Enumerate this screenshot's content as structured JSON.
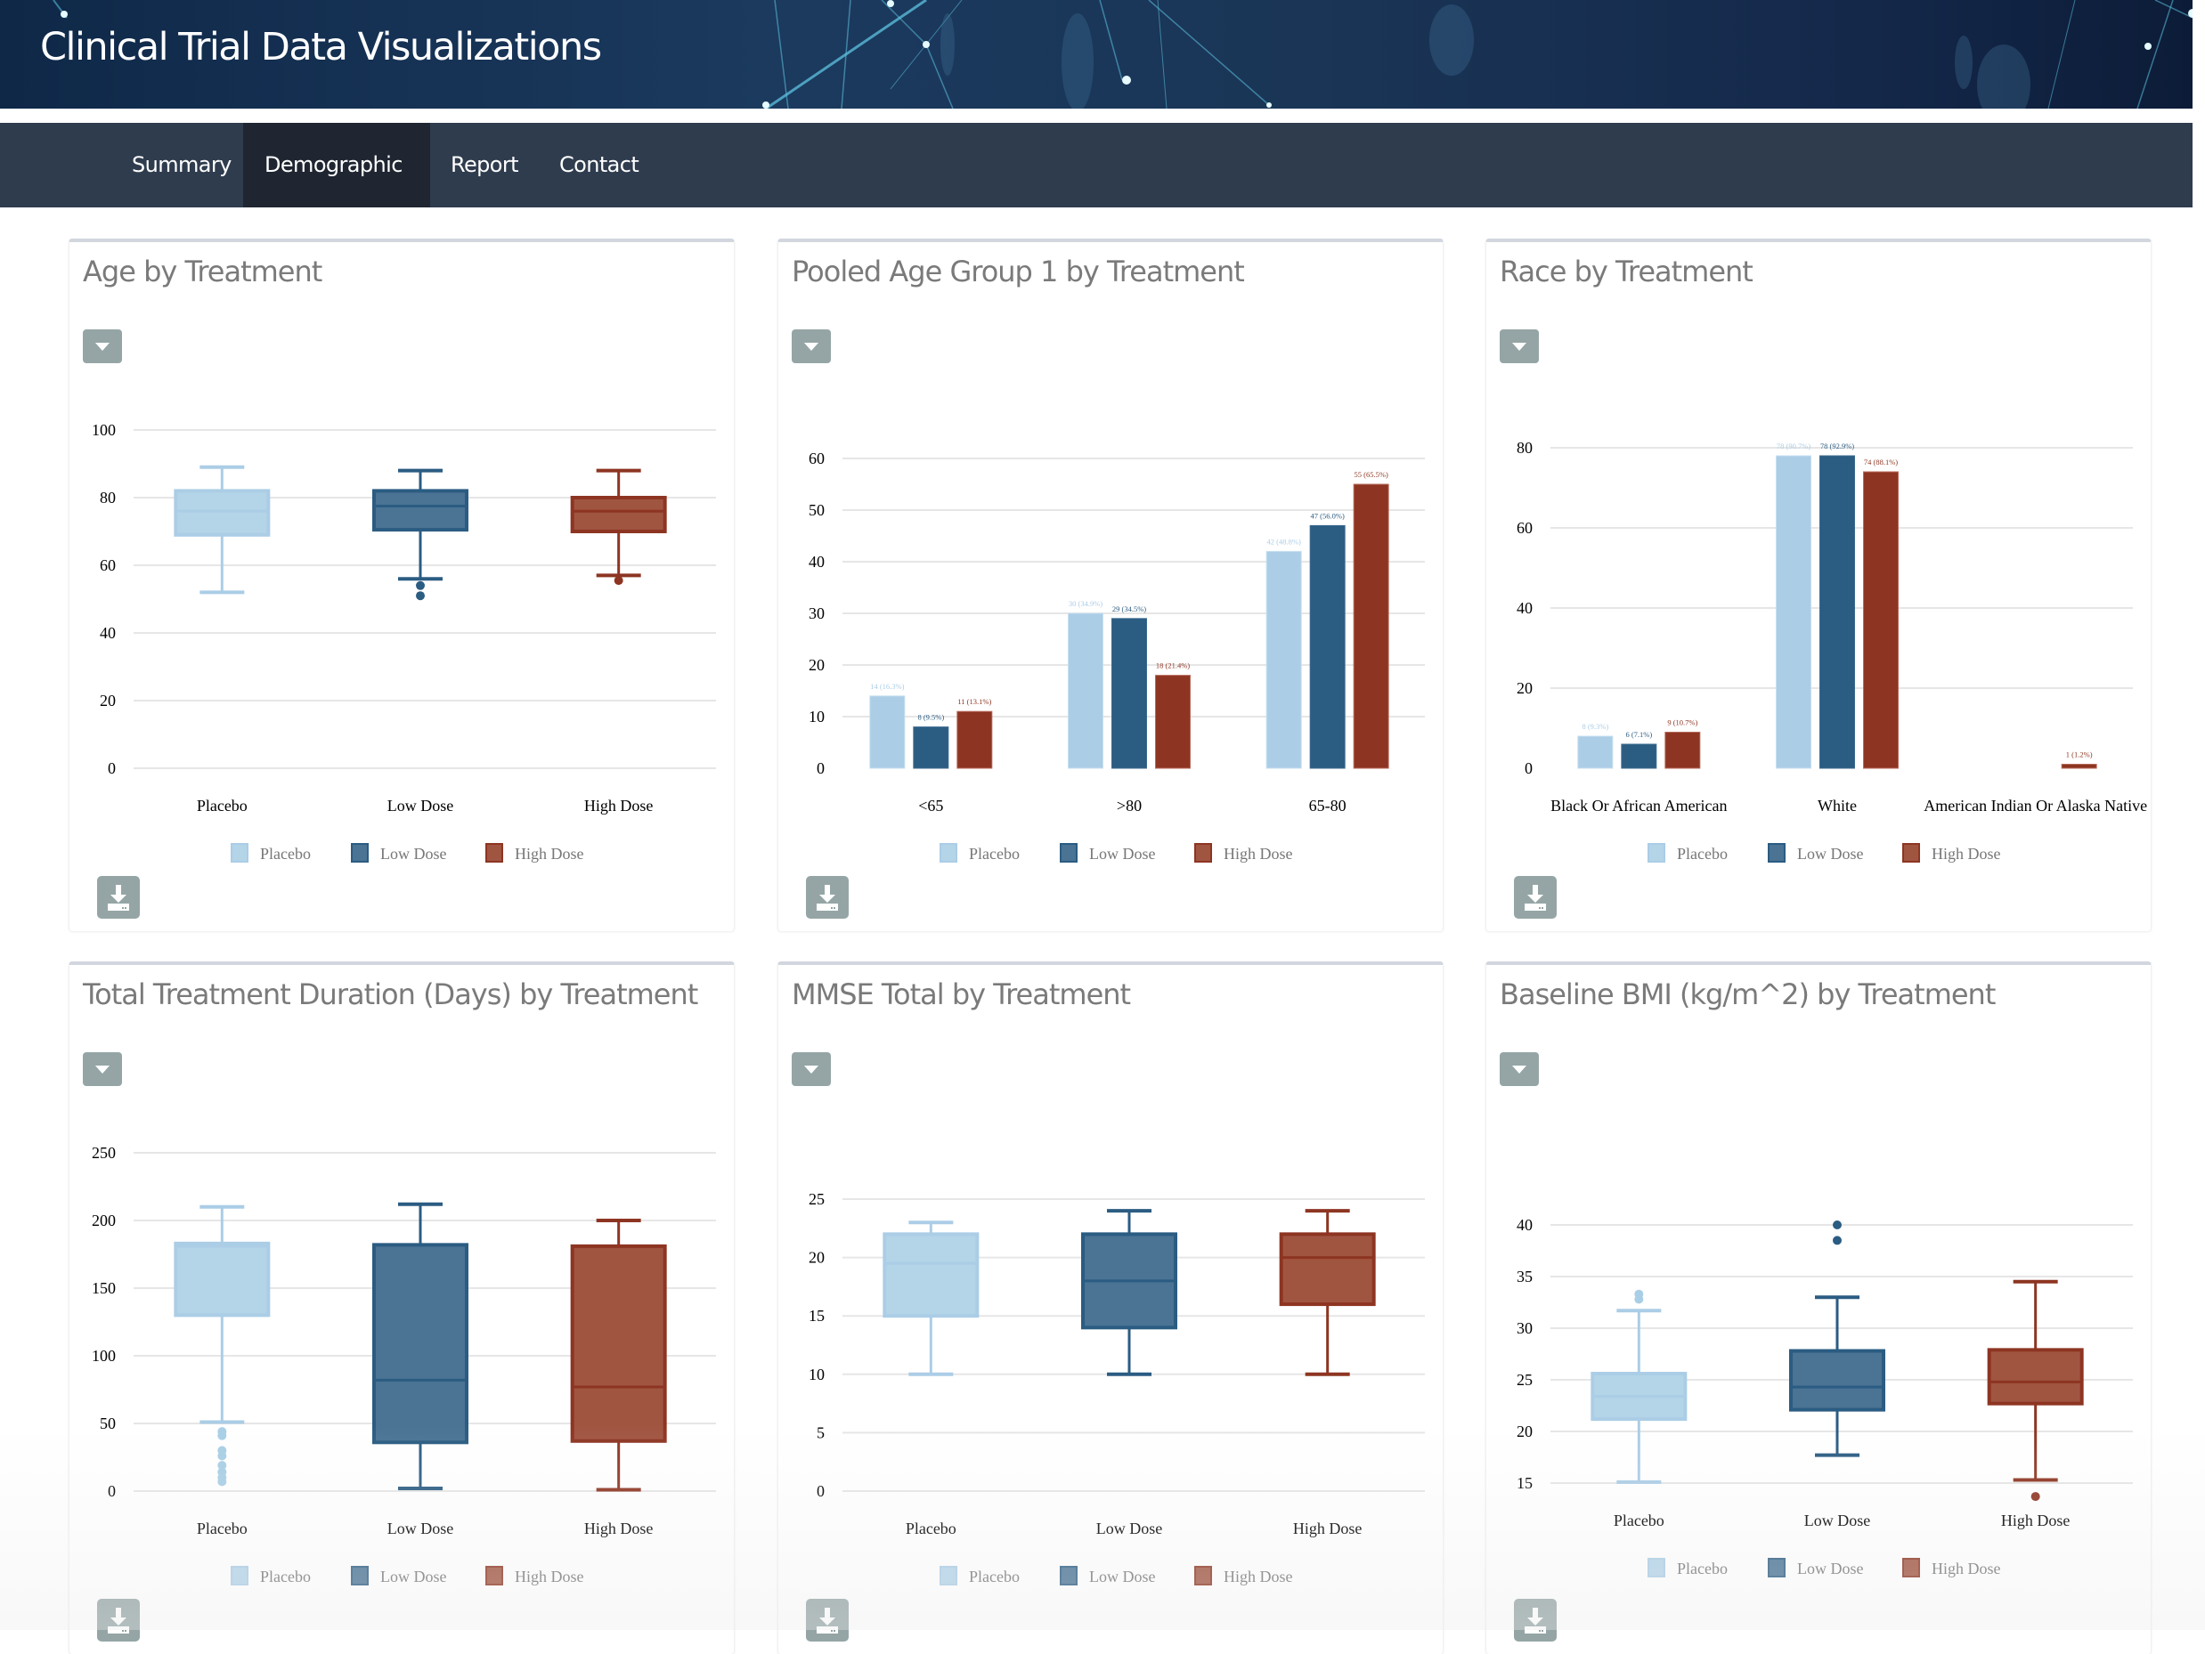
{
  "app": {
    "title": "Clinical Trial Data Visualizations"
  },
  "nav": {
    "items": [
      {
        "label": "Summary",
        "active": false,
        "has_caret": false
      },
      {
        "label": "Demographic",
        "active": true,
        "has_caret": true
      },
      {
        "label": "Report",
        "active": false,
        "has_caret": false
      },
      {
        "label": "Contact",
        "active": false,
        "has_caret": false
      }
    ]
  },
  "colors": {
    "placebo": "#abcde6",
    "low_dose": "#2b5c82",
    "high_dose": "#8d3522",
    "placebo_box": "#b4d4e8",
    "low_dose_box": "#4a7394",
    "high_dose_box": "#a05541",
    "button_gray": "#95a5a6",
    "navbar": "#2f3c4e",
    "navbar_active": "#1f2631"
  },
  "legend": [
    "Placebo",
    "Low Dose",
    "High Dose"
  ],
  "icons": {
    "dropdown": "caret-down-icon",
    "download": "download-icon"
  },
  "chart_data": [
    {
      "id": "age",
      "type": "boxplot",
      "title": "Age by Treatment",
      "categories": [
        "Placebo",
        "Low Dose",
        "High Dose"
      ],
      "ylim": [
        0,
        100
      ],
      "yticks": [
        0,
        20,
        40,
        60,
        80,
        100
      ],
      "grid": true,
      "legend_position": "bottom",
      "series": [
        {
          "name": "Placebo",
          "min": 52,
          "q1": 69,
          "median": 76,
          "q3": 82,
          "max": 89,
          "outliers": []
        },
        {
          "name": "Low Dose",
          "min": 56,
          "q1": 70.5,
          "median": 77.5,
          "q3": 82,
          "max": 88,
          "outliers": [
            54,
            51
          ]
        },
        {
          "name": "High Dose",
          "min": 57,
          "q1": 70,
          "median": 76,
          "q3": 80,
          "max": 88,
          "outliers": [
            55.5
          ]
        }
      ]
    },
    {
      "id": "agegr",
      "type": "bar",
      "title": "Pooled Age Group 1 by Treatment",
      "categories": [
        "<65",
        ">80",
        "65-80"
      ],
      "ylim": [
        0,
        60
      ],
      "yticks": [
        0,
        10,
        20,
        30,
        40,
        50,
        60
      ],
      "grid": true,
      "legend_position": "bottom",
      "series": [
        {
          "name": "Placebo",
          "values": [
            14,
            30,
            42
          ],
          "labels": [
            "14 (16.3%)",
            "30 (34.9%)",
            "42 (48.8%)"
          ]
        },
        {
          "name": "Low Dose",
          "values": [
            8,
            29,
            47
          ],
          "labels": [
            "8 (9.5%)",
            "29 (34.5%)",
            "47 (56.0%)"
          ]
        },
        {
          "name": "High Dose",
          "values": [
            11,
            18,
            55
          ],
          "labels": [
            "11 (13.1%)",
            "18 (21.4%)",
            "55 (65.5%)"
          ]
        }
      ]
    },
    {
      "id": "race",
      "type": "bar",
      "title": "Race by Treatment",
      "categories": [
        "Black Or African American",
        "White",
        "American Indian Or Alaska Native"
      ],
      "ylim": [
        0,
        80
      ],
      "yticks": [
        0,
        20,
        40,
        60,
        80
      ],
      "grid": true,
      "legend_position": "bottom",
      "series": [
        {
          "name": "Placebo",
          "values": [
            8,
            78,
            0
          ],
          "labels": [
            "8 (9.3%)",
            "78 (90.7%)",
            ""
          ]
        },
        {
          "name": "Low Dose",
          "values": [
            6,
            78,
            0
          ],
          "labels": [
            "6 (7.1%)",
            "78 (92.9%)",
            ""
          ]
        },
        {
          "name": "High Dose",
          "values": [
            9,
            74,
            1
          ],
          "labels": [
            "9 (10.7%)",
            "74 (88.1%)",
            "1 (1.2%)"
          ]
        }
      ]
    },
    {
      "id": "trtdur",
      "type": "boxplot",
      "title": "Total Treatment Duration (Days) by Treatment",
      "categories": [
        "Placebo",
        "Low Dose",
        "High Dose"
      ],
      "ylim": [
        0,
        250
      ],
      "yticks": [
        0,
        50,
        100,
        150,
        200,
        250
      ],
      "grid": true,
      "legend_position": "bottom",
      "series": [
        {
          "name": "Placebo",
          "min": 51,
          "q1": 130,
          "median": 181,
          "q3": 183,
          "max": 210,
          "outliers": [
            44,
            41,
            30,
            26,
            19,
            14,
            10,
            7
          ]
        },
        {
          "name": "Low Dose",
          "min": 2,
          "q1": 36,
          "median": 82,
          "q3": 182,
          "max": 212,
          "outliers": []
        },
        {
          "name": "High Dose",
          "min": 1,
          "q1": 37,
          "median": 77,
          "q3": 181,
          "max": 200,
          "outliers": []
        }
      ]
    },
    {
      "id": "mmse",
      "type": "boxplot",
      "title": "MMSE Total by Treatment",
      "categories": [
        "Placebo",
        "Low Dose",
        "High Dose"
      ],
      "ylim": [
        0,
        25
      ],
      "yticks": [
        0,
        5,
        10,
        15,
        20,
        25
      ],
      "grid": true,
      "legend_position": "bottom",
      "series": [
        {
          "name": "Placebo",
          "min": 10,
          "q1": 15,
          "median": 19.5,
          "q3": 22,
          "max": 23,
          "outliers": []
        },
        {
          "name": "Low Dose",
          "min": 10,
          "q1": 14,
          "median": 18,
          "q3": 22,
          "max": 24,
          "outliers": []
        },
        {
          "name": "High Dose",
          "min": 10,
          "q1": 16,
          "median": 20,
          "q3": 22,
          "max": 24,
          "outliers": []
        }
      ]
    },
    {
      "id": "bmi",
      "type": "boxplot",
      "title": "Baseline BMI (kg/m^2) by Treatment",
      "categories": [
        "Placebo",
        "Low Dose",
        "High Dose"
      ],
      "ylim": [
        15,
        40
      ],
      "yticks": [
        15,
        20,
        25,
        30,
        35,
        40
      ],
      "grid": true,
      "legend_position": "bottom",
      "series": [
        {
          "name": "Placebo",
          "min": 15.1,
          "q1": 21.2,
          "median": 23.4,
          "q3": 25.6,
          "max": 31.7,
          "outliers": [
            33.3,
            32.8
          ]
        },
        {
          "name": "Low Dose",
          "min": 17.7,
          "q1": 22.1,
          "median": 24.3,
          "q3": 27.8,
          "max": 33.0,
          "outliers": [
            40.0,
            38.5
          ]
        },
        {
          "name": "High Dose",
          "min": 15.3,
          "q1": 22.7,
          "median": 24.8,
          "q3": 27.9,
          "max": 34.5,
          "outliers": [
            13.7
          ]
        }
      ]
    }
  ]
}
